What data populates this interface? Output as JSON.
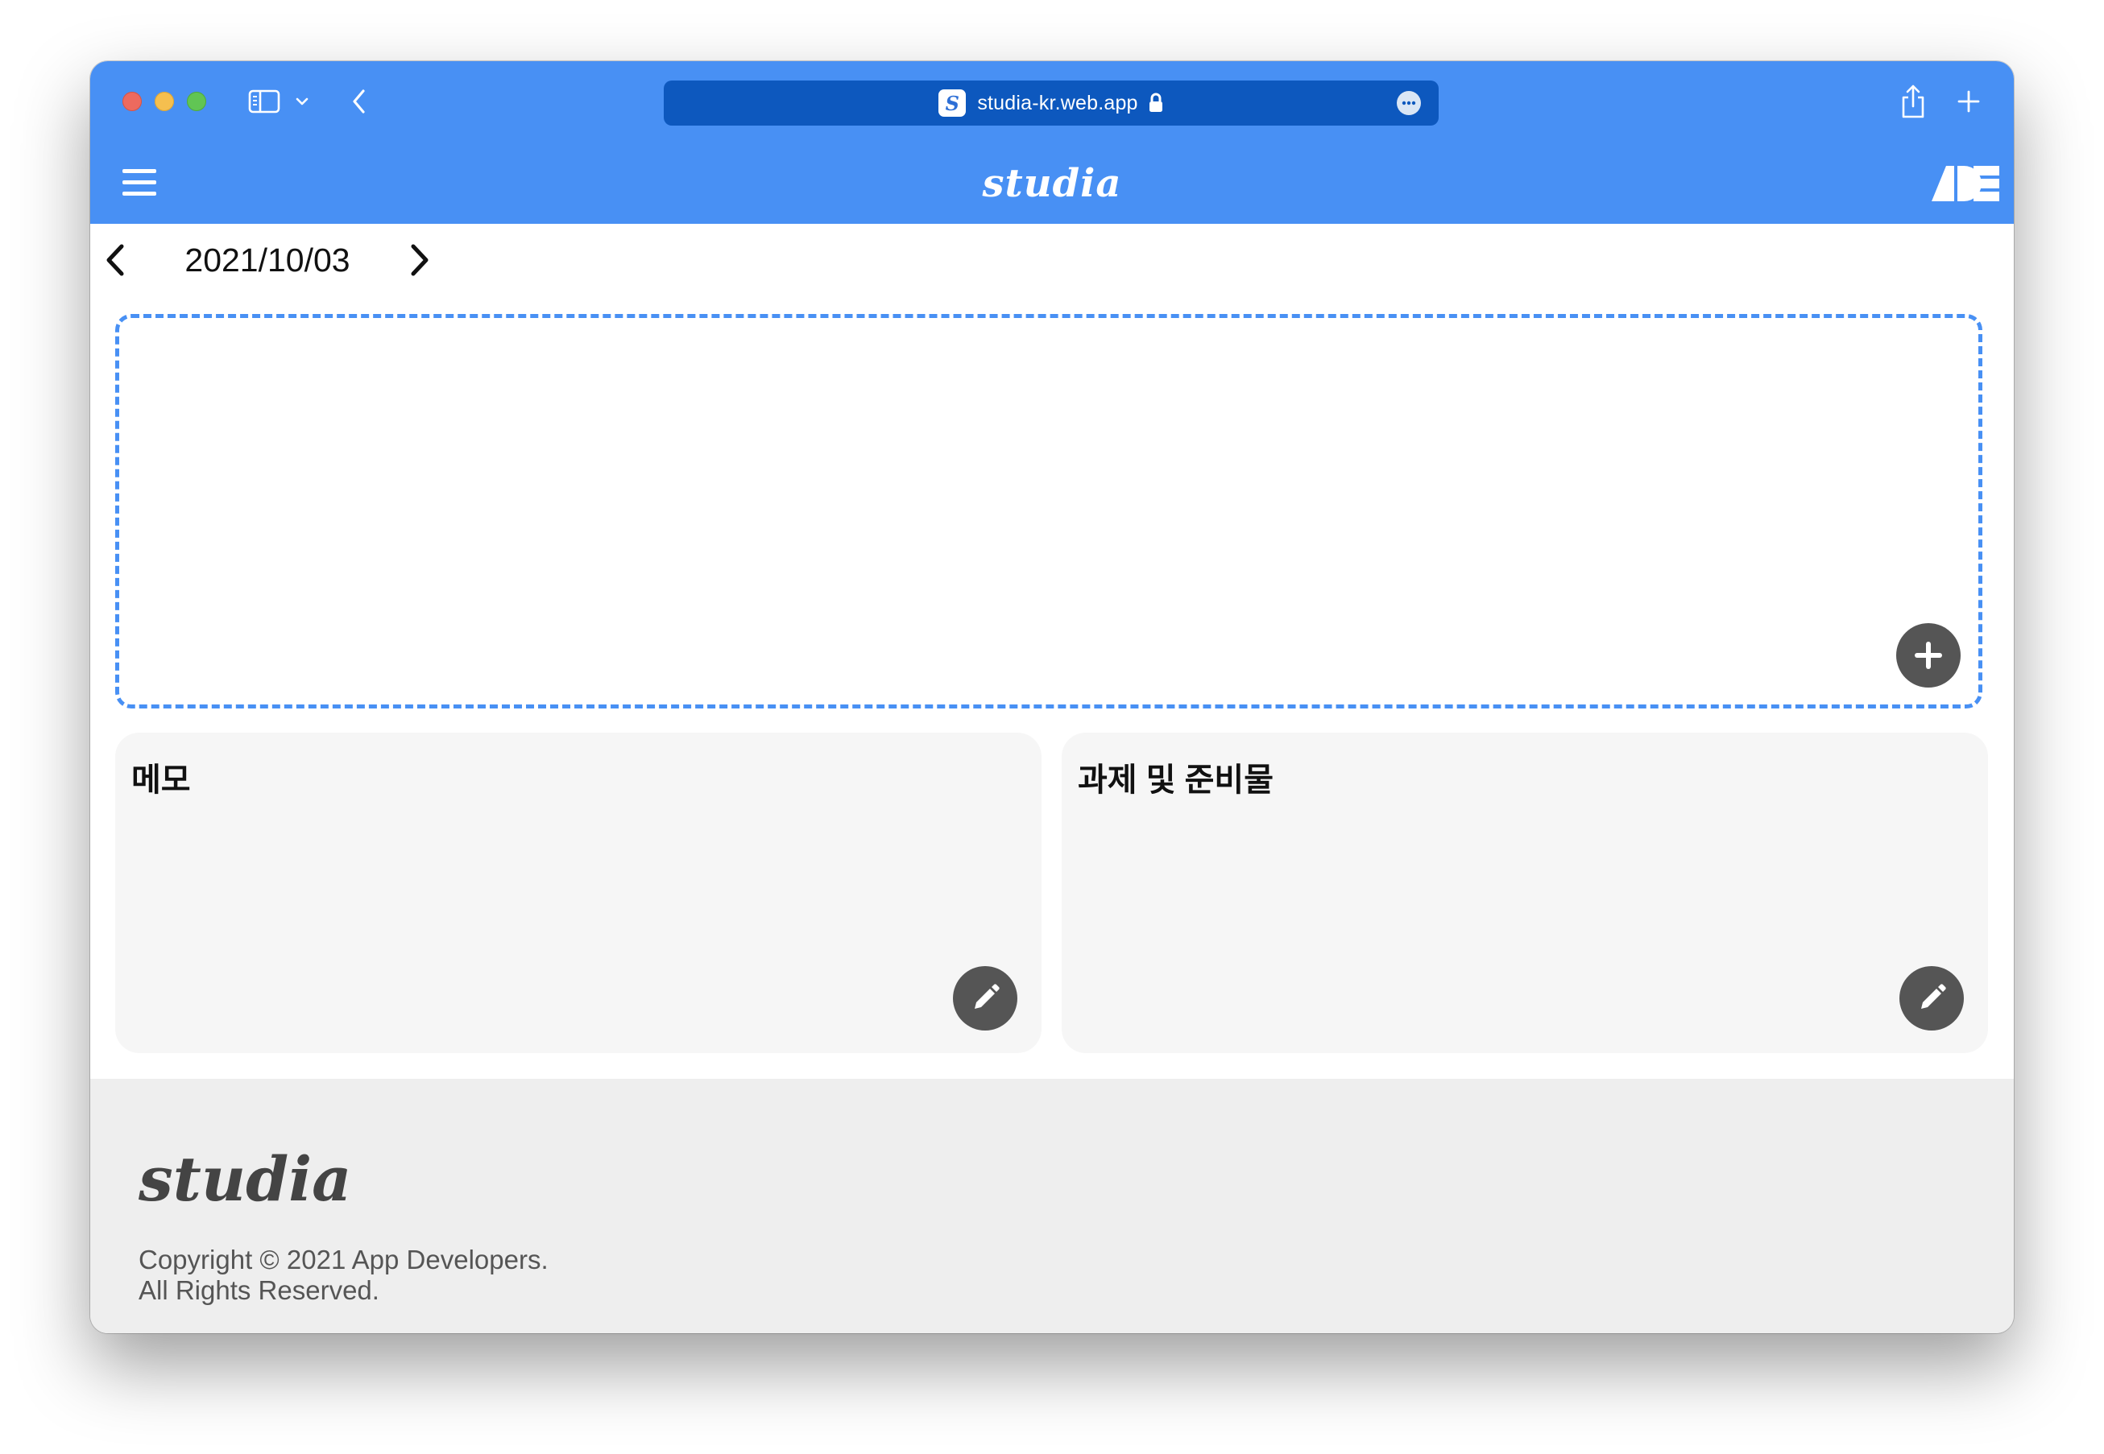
{
  "browser": {
    "url": "studia-kr.web.app",
    "favicon_letter": "S"
  },
  "header": {
    "brand": "studia",
    "accent_color": "#4890f4"
  },
  "date_nav": {
    "date": "2021/10/03"
  },
  "timetable": {
    "border_color": "#4890f4",
    "add_icon": "plus-icon"
  },
  "cards": [
    {
      "title": "메모",
      "edit_icon": "pencil-icon"
    },
    {
      "title": "과제 및 준비물",
      "edit_icon": "pencil-icon"
    }
  ],
  "footer": {
    "brand": "studia",
    "copyright_line1": "Copyright © 2021 App Developers.",
    "copyright_line2": "All Rights Reserved."
  }
}
